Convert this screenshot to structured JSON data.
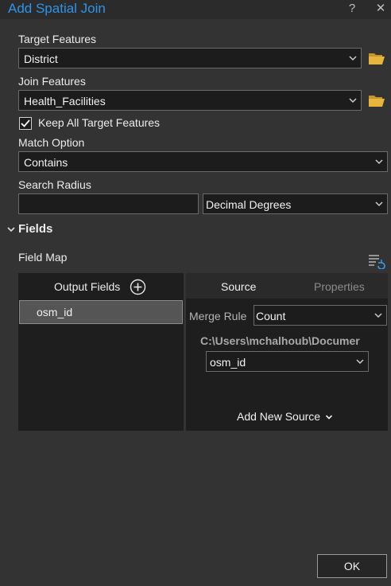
{
  "dialog": {
    "title": "Add Spatial Join",
    "help_label": "?",
    "close_label": "✕"
  },
  "target_features": {
    "label": "Target Features",
    "value": "District"
  },
  "join_features": {
    "label": "Join Features",
    "value": "Health_Facilities"
  },
  "keep_all": {
    "label": "Keep All Target Features",
    "checked": true
  },
  "match_option": {
    "label": "Match Option",
    "value": "Contains"
  },
  "search_radius": {
    "label": "Search Radius",
    "value": "",
    "units": "Decimal Degrees"
  },
  "fields": {
    "section_label": "Fields",
    "field_map_label": "Field Map",
    "output_fields_label": "Output Fields",
    "output_fields": [
      "osm_id"
    ],
    "tabs": {
      "source": "Source",
      "properties": "Properties"
    },
    "merge_rule_label": "Merge Rule",
    "merge_rule_value": "Count",
    "source_path": "C:\\Users\\mchalhoub\\Documer",
    "source_field": "osm_id",
    "add_new_source_label": "Add New Source"
  },
  "ok_label": "OK",
  "colors": {
    "background": "#333333",
    "title": "#2f94e8",
    "selected_row": "#555555",
    "folder": "#e8b53c"
  }
}
